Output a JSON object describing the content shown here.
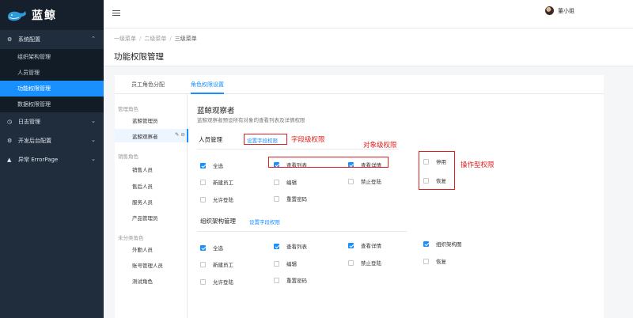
{
  "brand": {
    "name": "蓝鲸"
  },
  "sidebar": {
    "groups": [
      {
        "label": "系统配置",
        "icon": "gear-icon",
        "expanded": true,
        "items": [
          {
            "label": "组织架构管理"
          },
          {
            "label": "人员管理"
          },
          {
            "label": "功能权限管理",
            "active": true
          },
          {
            "label": "数据权限管理"
          }
        ]
      },
      {
        "label": "日志管理",
        "icon": "clock-icon"
      },
      {
        "label": "开发后台配置",
        "icon": "gear-icon"
      },
      {
        "label": "异常 ErrorPage",
        "icon": "warning-icon"
      }
    ]
  },
  "header": {
    "user_name": "董小姐"
  },
  "breadcrumb": {
    "items": [
      "一级菜单",
      "二级菜单",
      "三级菜单"
    ],
    "separator": "/"
  },
  "page": {
    "title": "功能权限管理"
  },
  "tabs": [
    {
      "label": "员工角色分配"
    },
    {
      "label": "角色权限设置",
      "active": true
    }
  ],
  "roles": {
    "groups": [
      {
        "title": "管理角色",
        "items": [
          "蓝鲸管理员",
          "蓝鲸观察者"
        ]
      },
      {
        "title": "销售角色",
        "items": [
          "销售人员",
          "售后人员",
          "服务人员",
          "产品管理员"
        ]
      },
      {
        "title": "未分类角色",
        "items": [
          "外勤人员",
          "账号管理人员",
          "测试角色"
        ]
      }
    ],
    "active": "蓝鲸观察者"
  },
  "detail": {
    "title": "蓝鲸观察者",
    "description": "蓝鲸观察者预设所有对象的查看列表及详情权限"
  },
  "sections": [
    {
      "title": "人员管理",
      "set_link": "设置字段权限",
      "permissions": [
        {
          "label": "全选",
          "checked": true
        },
        {
          "label": "查看列表",
          "checked": true
        },
        {
          "label": "查看详情",
          "checked": true
        },
        {
          "label": "停用",
          "checked": false
        },
        {
          "label": "新建员工",
          "checked": false
        },
        {
          "label": "编辑",
          "checked": false
        },
        {
          "label": "禁止登陆",
          "checked": false
        },
        {
          "label": "恢复",
          "checked": false
        },
        {
          "label": "允许登陆",
          "checked": false
        },
        {
          "label": "重置密码",
          "checked": false
        }
      ]
    },
    {
      "title": "组织架构管理",
      "set_link": "设置字段权限",
      "permissions": [
        {
          "label": "全选",
          "checked": true
        },
        {
          "label": "查看列表",
          "checked": true
        },
        {
          "label": "查看详情",
          "checked": true
        },
        {
          "label": "组织架构图",
          "checked": true
        },
        {
          "label": "新建员工",
          "checked": false
        },
        {
          "label": "编辑",
          "checked": false
        },
        {
          "label": "禁止登陆",
          "checked": false
        },
        {
          "label": "恢复",
          "checked": false
        },
        {
          "label": "允许登陆",
          "checked": false
        },
        {
          "label": "重置密码",
          "checked": false
        }
      ]
    }
  ],
  "annotations": {
    "field_level": "字段级权限",
    "object_level": "对象级权限",
    "operation_level": "操作型权限"
  },
  "colors": {
    "accent": "#1890ff",
    "sidebar_bg": "#1f2d3d",
    "annotation": "#e02020"
  }
}
